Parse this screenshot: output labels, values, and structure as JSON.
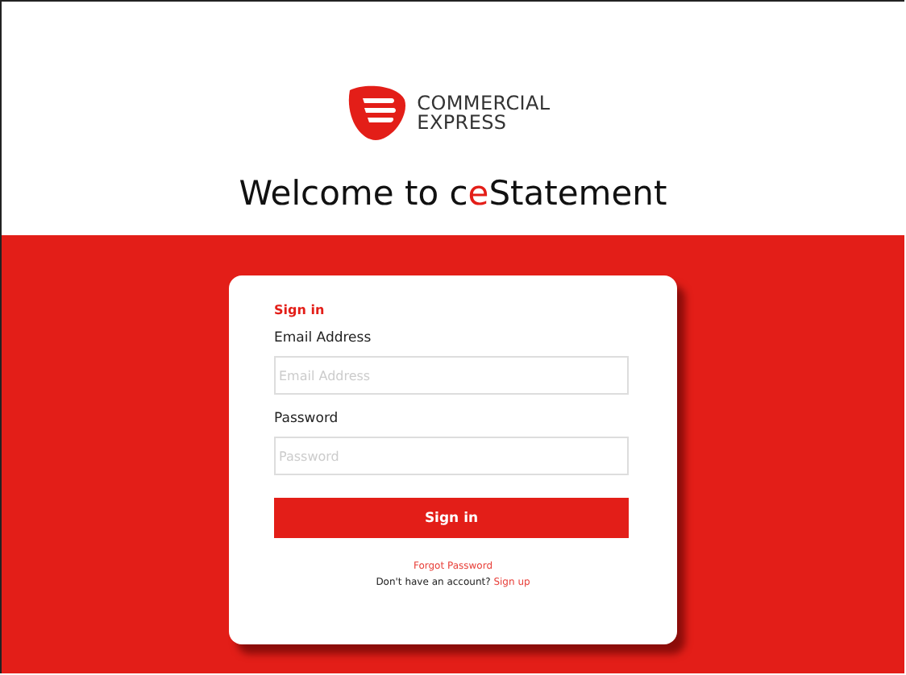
{
  "brand": {
    "line_1": "COMMERCIAL",
    "line_2": "EXPRESS"
  },
  "title_parts": [
    {
      "text": "Welcome to c",
      "accent": false
    },
    {
      "text": "e",
      "accent": true
    },
    {
      "text": "Statement",
      "accent": false
    }
  ],
  "form": {
    "heading": "Sign in",
    "fields": [
      {
        "label": "Email Address",
        "placeholder": "Email Address"
      },
      {
        "label": "Password",
        "placeholder": "Password"
      }
    ],
    "submit": "Sign in",
    "forgot_link": "Forgot Password",
    "signup_prompt": "Don't have an account?",
    "signup_link": "Sign up"
  }
}
